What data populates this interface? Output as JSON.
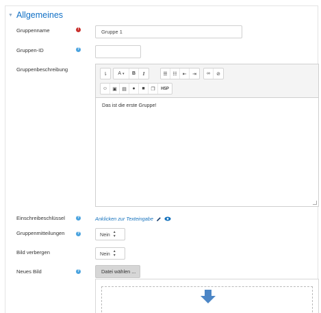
{
  "section": {
    "title": "Allgemeines"
  },
  "fields": {
    "name": {
      "label": "Gruppenname",
      "value": "Gruppe 1"
    },
    "id": {
      "label": "Gruppen-ID",
      "value": ""
    },
    "description": {
      "label": "Gruppenbeschreibung",
      "content": "Das ist die erste Gruppe!"
    },
    "enrolment_key": {
      "label": "Einschreibeschlüssel",
      "link": "Anklicken zur Texteingabe"
    },
    "messaging": {
      "label": "Gruppenmitteilungen",
      "value": "Nein"
    },
    "hide_picture": {
      "label": "Bild verbergen",
      "value": "Nein"
    },
    "new_picture": {
      "label": "Neues Bild",
      "button": "Datei wählen ..."
    }
  },
  "toolbar": {
    "font_label": "A",
    "bold_label": "B",
    "italic_label": "I",
    "h5p_label": "H5P"
  },
  "colors": {
    "accent": "#0f6fc5",
    "required": "#c9302c",
    "help": "#4aa3df",
    "link": "#1572bd",
    "drop_arrow": "#4c86c6"
  }
}
